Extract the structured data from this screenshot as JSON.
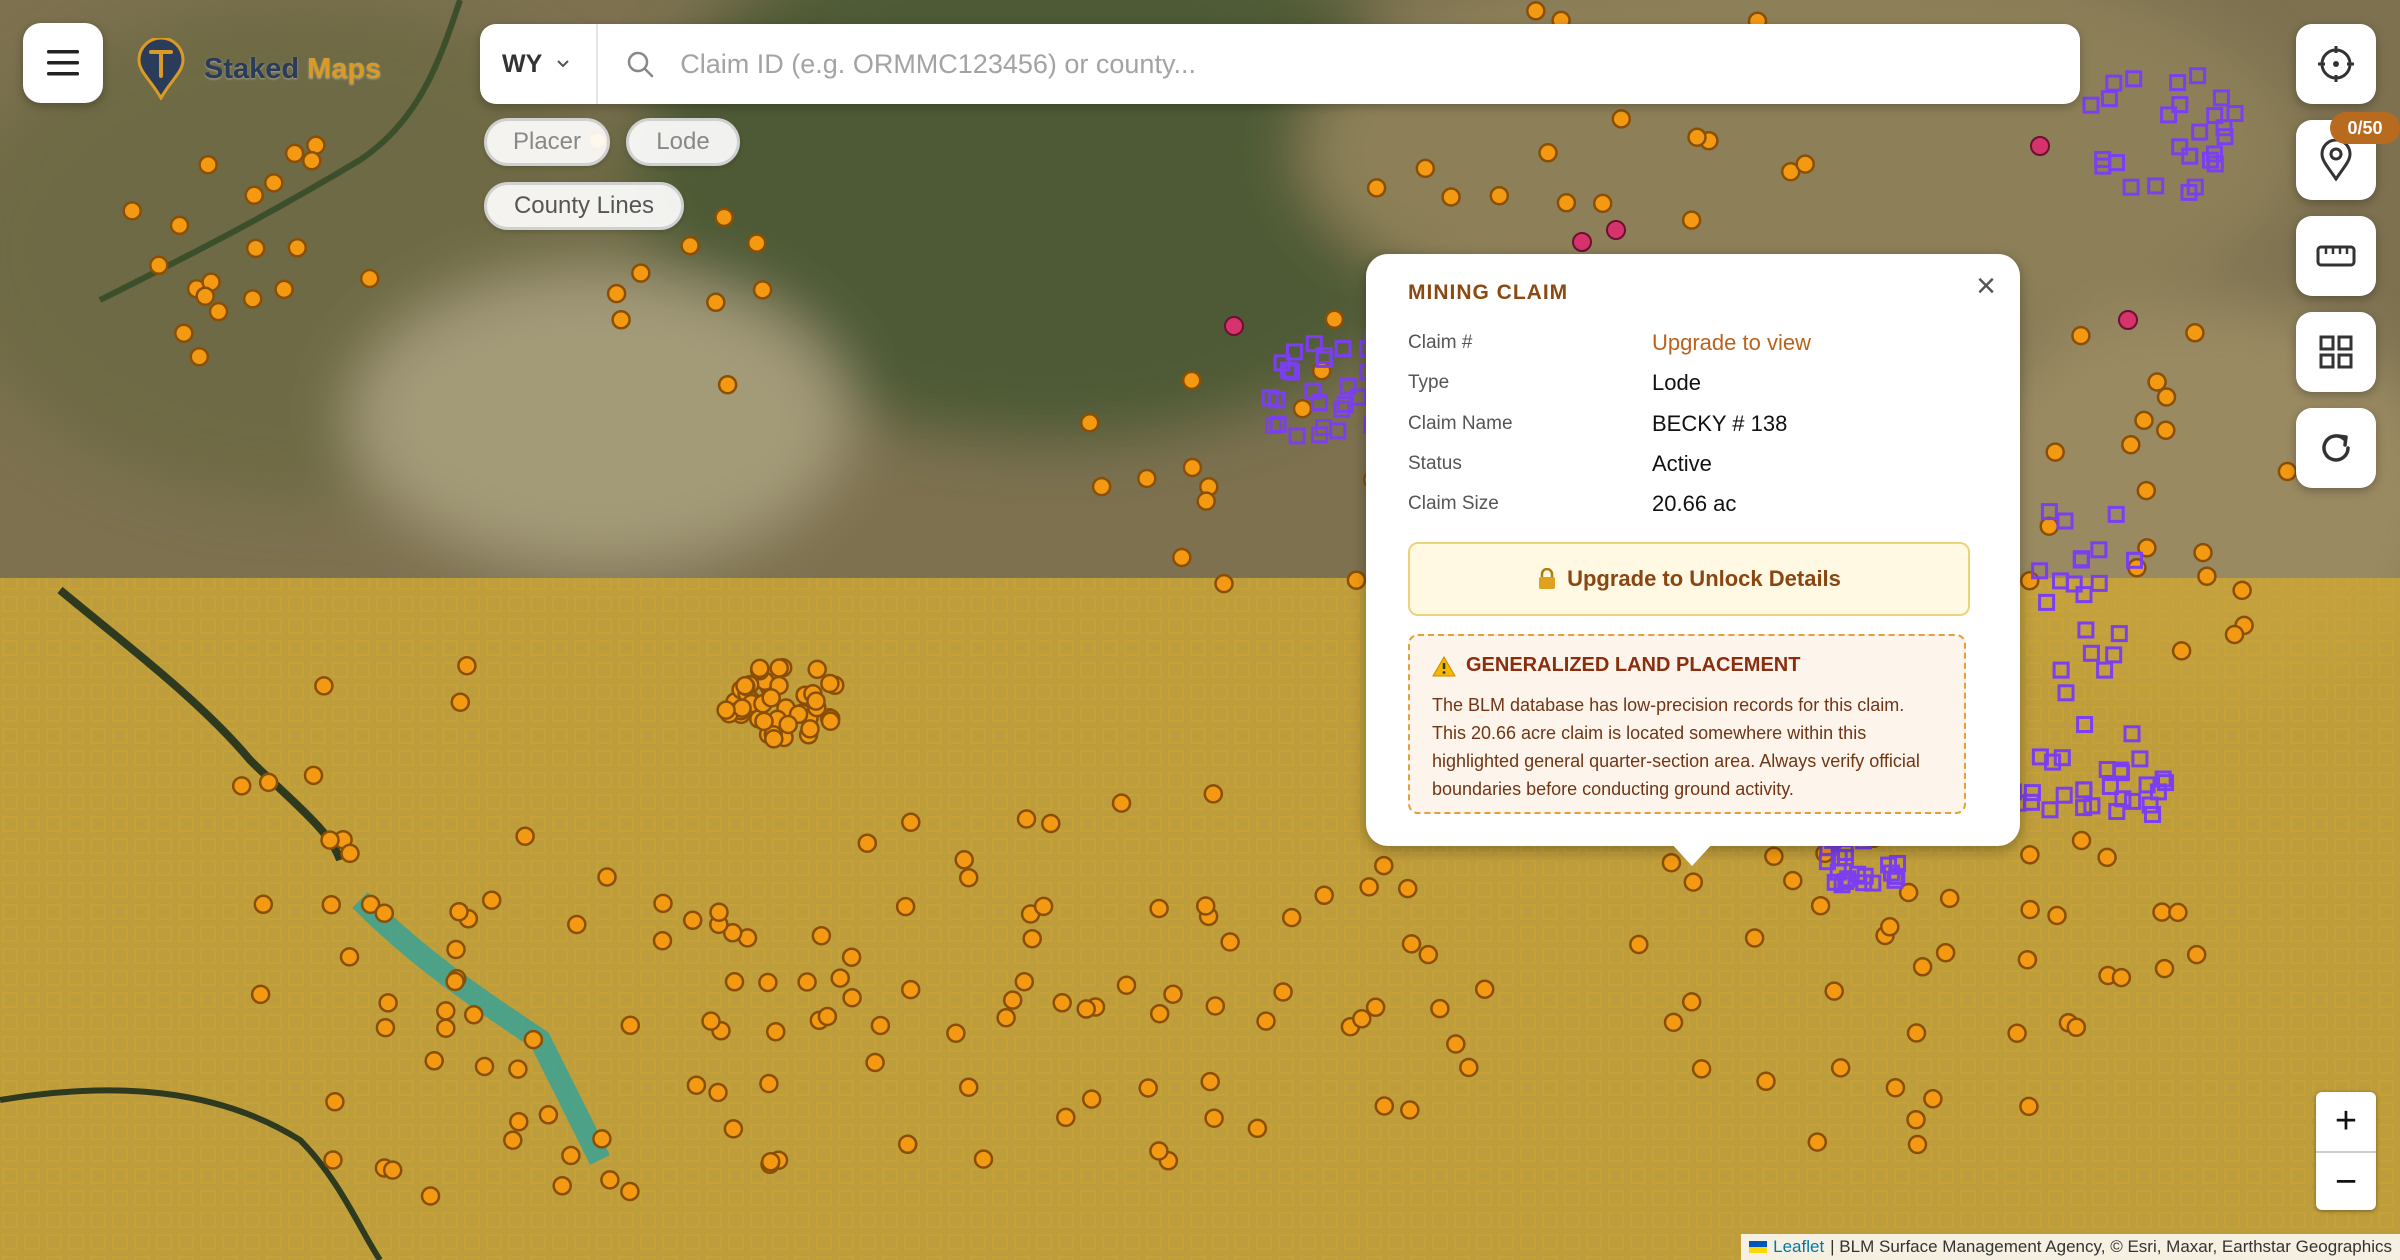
{
  "app": {
    "brand_first": "Staked",
    "brand_second": "Maps",
    "accent": "#d99a26",
    "brand_dark": "#2a3c5a"
  },
  "icons": {
    "menu": "hamburger-menu-icon",
    "logo": "pin-logo-icon",
    "search": "search-icon",
    "dropdown": "chevron-down-icon",
    "locate": "crosshair-locate-icon",
    "saved": "map-pin-icon",
    "measure": "ruler-icon",
    "layers": "grid-layers-icon",
    "refresh": "refresh-icon",
    "lock": "lock-icon",
    "warning": "warning-icon"
  },
  "search": {
    "state": "WY",
    "placeholder": "Claim ID (e.g. ORMMC123456) or county..."
  },
  "filters": {
    "placer": "Placer",
    "lode": "Lode",
    "county_lines": "County Lines"
  },
  "saved_badge": "0/50",
  "popup": {
    "title": "MINING CLAIM",
    "rows": [
      {
        "label": "Claim #",
        "value": "Upgrade to view"
      },
      {
        "label": "Type",
        "value": "Lode"
      },
      {
        "label": "Claim Name",
        "value": "BECKY # 138"
      },
      {
        "label": "Status",
        "value": "Active"
      },
      {
        "label": "Claim Size",
        "value": "20.66 ac"
      }
    ],
    "unlock_label": "Upgrade to Unlock Details",
    "notice_title": "GENERALIZED LAND PLACEMENT",
    "notice_text": "The BLM database has low-precision records for this claim. This 20.66 acre claim is located somewhere within this highlighted general quarter-section area. Always verify official boundaries before conducting ground activity.",
    "close": "×"
  },
  "zoom": {
    "in": "+",
    "out": "−"
  },
  "attribution": {
    "leaflet": "Leaflet",
    "sources": "| BLM Surface Management Agency, © Esri, Maxar, Earthstar Geographics"
  },
  "colors": {
    "claim_marker": "#f39a12",
    "claim_marker_stroke": "#8a4f06",
    "closed_marker": "#d6336c",
    "claim_parcel": "#7b3ff0",
    "blm_overlay": "#e0b530"
  }
}
